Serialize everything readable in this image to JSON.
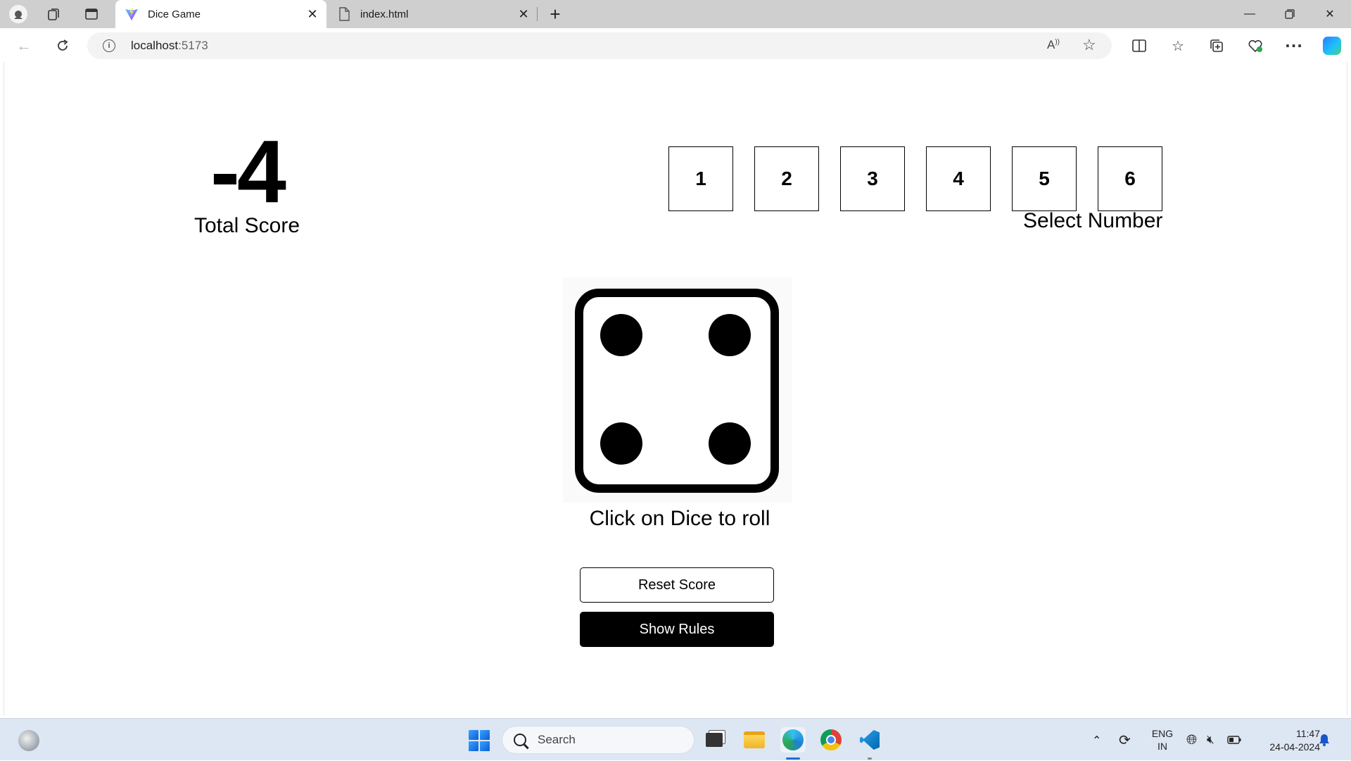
{
  "browser": {
    "tabs": [
      {
        "label": "Dice Game",
        "icon": "vite-logo-icon",
        "active": true
      },
      {
        "label": "index.html",
        "icon": "file-icon",
        "active": false
      }
    ],
    "address": {
      "host": "localhost",
      "port": ":5173"
    }
  },
  "game": {
    "total_score": "-4",
    "total_score_label": "Total Score",
    "numbers": [
      "1",
      "2",
      "3",
      "4",
      "5",
      "6"
    ],
    "select_label": "Select Number",
    "dice_value": 4,
    "roll_hint": "Click on Dice to roll",
    "reset_label": "Reset Score",
    "rules_label": "Show Rules"
  },
  "taskbar": {
    "search_placeholder": "Search",
    "language_line1": "ENG",
    "language_line2": "IN",
    "time": "11:47",
    "date": "24-04-2024"
  },
  "colors": {
    "accent": "#000000",
    "tabbar_bg": "#cfcfcf",
    "taskbar_bg": "#dde6f3"
  }
}
